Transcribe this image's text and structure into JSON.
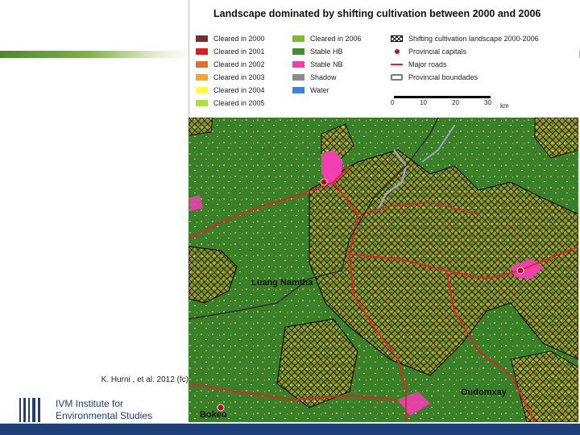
{
  "credit": "K. Hurni , et al. 2012 (fc)",
  "logo": {
    "line1_prefix": "IVM",
    "line1_rest": " Institute for",
    "line2": "Environmental Studies"
  },
  "colors": {
    "brand_blue": "#1f3f7a",
    "accent_green": "#6fa83a"
  },
  "map": {
    "legend_title": "Landscape dominated by shifting cultivation between 2000 and 2006",
    "legend": [
      {
        "label": "Cleared in 2000",
        "color": "#7a2e2e",
        "kind": "fill"
      },
      {
        "label": "Cleared in 2001",
        "color": "#e31a1c",
        "kind": "fill"
      },
      {
        "label": "Cleared in 2002",
        "color": "#e0702a",
        "kind": "fill"
      },
      {
        "label": "Cleared in 2003",
        "color": "#f0a830",
        "kind": "fill"
      },
      {
        "label": "Cleared in 2004",
        "color": "#ffff33",
        "kind": "fill"
      },
      {
        "label": "Cleared in 2005",
        "color": "#aee23a",
        "kind": "fill"
      },
      {
        "label": "Cleared in 2006",
        "color": "#7cbc2c",
        "kind": "fill"
      },
      {
        "label": "Stable HB",
        "color": "#3f8f2c",
        "kind": "fill"
      },
      {
        "label": "Stable NB",
        "color": "#ef3fb0",
        "kind": "fill"
      },
      {
        "label": "Shadow",
        "color": "#8a8a8a",
        "kind": "fill"
      },
      {
        "label": "Water",
        "color": "#3f7fe0",
        "kind": "fill"
      },
      {
        "label": "Shifting cultivation landscape 2000-2006",
        "kind": "hatch"
      },
      {
        "label": "Provincial capitals",
        "kind": "dot"
      },
      {
        "label": "Major roads",
        "kind": "line"
      },
      {
        "label": "Provincial boundades",
        "kind": "box"
      }
    ],
    "scale": {
      "ticks": [
        "0",
        "10",
        "20",
        "30"
      ],
      "unit": "km"
    },
    "place_labels": [
      "Luang Namtha",
      "Oudomxay",
      "Bokeo"
    ]
  }
}
